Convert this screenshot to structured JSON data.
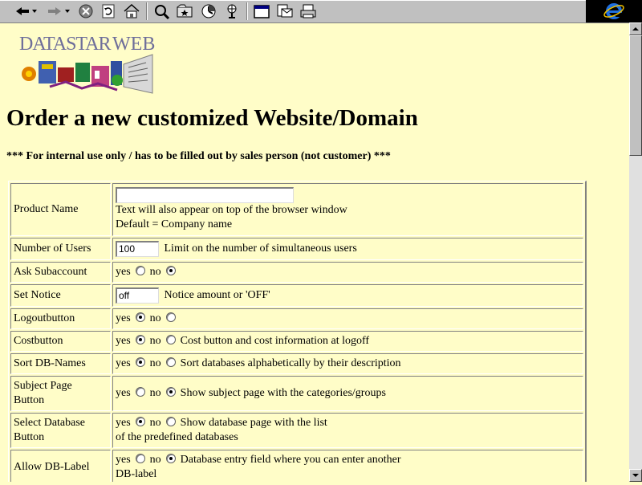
{
  "toolbar": {
    "icons": [
      "back-icon",
      "dropdown-icon",
      "forward-icon",
      "dropdown-icon",
      "stop-icon",
      "refresh-icon",
      "home-icon",
      "search-icon",
      "favorites-icon",
      "history-icon",
      "channels-icon",
      "fullscreen-icon",
      "mail-icon",
      "print-icon"
    ]
  },
  "logo": {
    "text": "DATASTAR WEB"
  },
  "page": {
    "title": "Order a new customized Website/Domain",
    "notice": "*** For internal use only / has to be filled out by sales person (not customer) ***"
  },
  "form": {
    "product_name": {
      "label": "Product Name",
      "value": "",
      "help1": "Text will also appear on top of the browser window",
      "help2": "Default = Company name"
    },
    "users": {
      "label": "Number of Users",
      "value": "100",
      "help": "Limit on the number of simultaneous users"
    },
    "subaccount": {
      "label": "Ask Subaccount",
      "selected": "no"
    },
    "notice_amount": {
      "label": "Set Notice",
      "value": "off",
      "help": "Notice amount or 'OFF'"
    },
    "logout": {
      "label": "Logoutbutton",
      "selected": "yes"
    },
    "cost": {
      "label": "Costbutton",
      "selected": "yes",
      "help": "Cost button and cost information at logoff"
    },
    "sort": {
      "label": "Sort DB-Names",
      "selected": "yes",
      "help": "Sort databases alphabetically by their description"
    },
    "subject": {
      "label1": "Subject Page",
      "label2": "Button",
      "selected": "no",
      "help": "Show subject page with the categories/groups"
    },
    "select_db": {
      "label1": "Select Database",
      "label2": "Button",
      "selected": "yes",
      "help1": "Show database page with the list",
      "help2": "of the predefined databases"
    },
    "allow_label": {
      "label1": "Allow DB-Label",
      "selected": "no",
      "help1": "Database entry field where you can enter another",
      "help2": "DB-label"
    },
    "yes": "yes",
    "no": "no"
  }
}
